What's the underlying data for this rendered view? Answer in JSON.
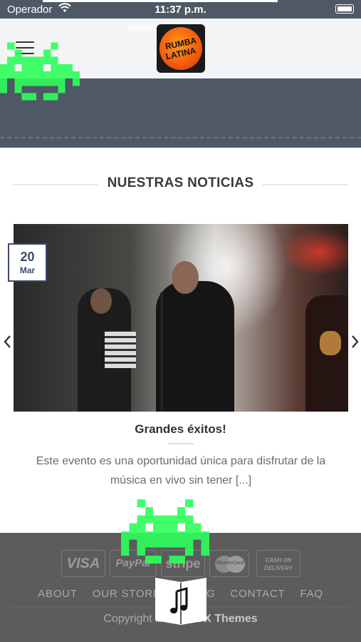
{
  "status_bar": {
    "carrier": "Operador",
    "time": "11:37 p.m."
  },
  "header": {
    "submit_text": "SUBMIT",
    "logo_line1": "RUMBA",
    "logo_line2": "LATINA"
  },
  "section": {
    "title": "NUESTRAS NOTICIAS"
  },
  "post": {
    "date_day": "20",
    "date_month": "Mar",
    "title": "Grandes éxitos!",
    "excerpt": "Este evento es una oportunidad única para disfrutar de la música en vivo sin tener [...]"
  },
  "footer": {
    "payments": {
      "visa": "VISA",
      "paypal": "PayPal",
      "stripe": "stripe",
      "mastercard": "MasterCard",
      "cash_line1": "CASH ON",
      "cash_line2": "DELIVERY"
    },
    "nav": [
      "ABOUT",
      "OUR STORES",
      "BLOG",
      "CONTACT",
      "FAQ"
    ],
    "copyright_prefix": "Copyright 2023 © ",
    "copyright_brand": "UX Themes"
  },
  "colors": {
    "status_bar": "#4f5865",
    "date_badge": "#3e4a72",
    "footer": "#5c5c5c",
    "invader": "#2dff5a"
  },
  "icons": {
    "menu": "hamburger-icon",
    "prev": "chevron-left-icon",
    "next": "chevron-right-icon",
    "music": "music-book-icon",
    "invader": "pixel-invader-icon"
  }
}
